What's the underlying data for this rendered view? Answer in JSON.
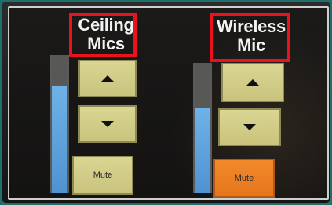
{
  "channels": [
    {
      "title_line1": "Ceiling",
      "title_line2": "Mics",
      "up_icon": "up-arrow-icon",
      "down_icon": "down-arrow-icon",
      "mute_label": "Mute",
      "level": 0.78,
      "muted": false
    },
    {
      "title_line1": "Wireless",
      "title_line2": "Mic",
      "up_icon": "up-arrow-icon",
      "down_icon": "down-arrow-icon",
      "mute_label": "Mute",
      "level": 0.65,
      "muted": true
    }
  ],
  "colors": {
    "button": "#d3cf8a",
    "mute_active": "#ee7f23",
    "meter_fill": "#5ba0dc",
    "highlight": "#e8131c"
  }
}
